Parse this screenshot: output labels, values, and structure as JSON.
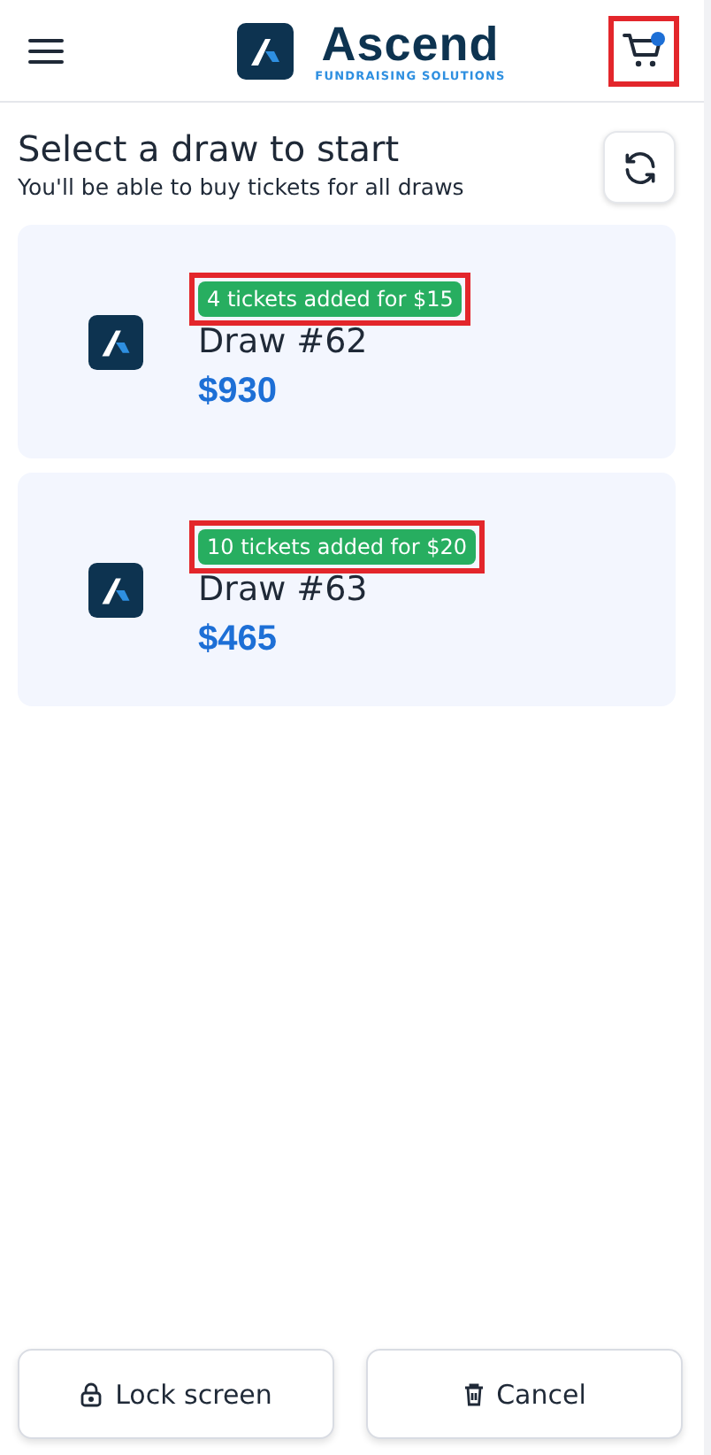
{
  "header": {
    "brand": "Ascend",
    "tagline": "FUNDRAISING SOLUTIONS",
    "cart": {
      "has_items": true,
      "highlighted": true
    }
  },
  "heading": {
    "title": "Select a draw to start",
    "subtitle": "You'll be able to buy tickets for all draws"
  },
  "draws": [
    {
      "badge": "4 tickets added for $15",
      "highlighted": true,
      "name": "Draw #62",
      "amount": "$930"
    },
    {
      "badge": "10 tickets added for $20",
      "highlighted": true,
      "name": "Draw #63",
      "amount": "$465"
    }
  ],
  "footer": {
    "buttons": [
      {
        "label": "Lock screen",
        "kind": "lock"
      },
      {
        "label": "Cancel",
        "kind": "trash"
      }
    ]
  }
}
